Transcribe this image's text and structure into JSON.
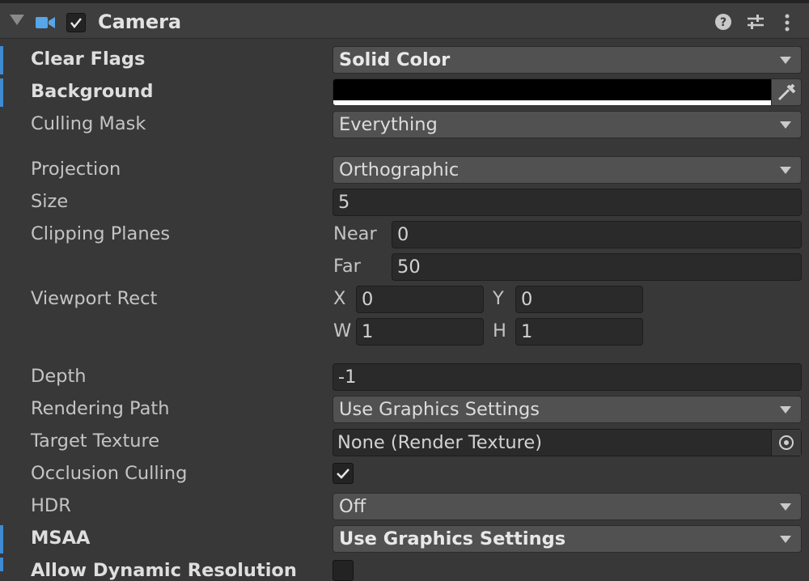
{
  "header": {
    "title": "Camera",
    "enabled": true,
    "icons": [
      "foldout-arrow-icon",
      "camera-icon",
      "help-icon",
      "presets-icon",
      "more-menu-icon"
    ]
  },
  "properties": {
    "clear_flags": {
      "label": "Clear Flags",
      "value": "Solid Color"
    },
    "background": {
      "label": "Background",
      "color": "#000000"
    },
    "culling_mask": {
      "label": "Culling Mask",
      "value": "Everything"
    },
    "projection": {
      "label": "Projection",
      "value": "Orthographic"
    },
    "size": {
      "label": "Size",
      "value": "5"
    },
    "clipping_planes": {
      "label": "Clipping Planes",
      "near_label": "Near",
      "near": "0",
      "far_label": "Far",
      "far": "50"
    },
    "viewport_rect": {
      "label": "Viewport Rect",
      "x_label": "X",
      "x": "0",
      "y_label": "Y",
      "y": "0",
      "w_label": "W",
      "w": "1",
      "h_label": "H",
      "h": "1"
    },
    "depth": {
      "label": "Depth",
      "value": "-1"
    },
    "rendering_path": {
      "label": "Rendering Path",
      "value": "Use Graphics Settings"
    },
    "target_texture": {
      "label": "Target Texture",
      "value": "None (Render Texture)"
    },
    "occlusion_culling": {
      "label": "Occlusion Culling",
      "checked": true
    },
    "hdr": {
      "label": "HDR",
      "value": "Off"
    },
    "msaa": {
      "label": "MSAA",
      "value": "Use Graphics Settings"
    },
    "allow_dynamic_resolution": {
      "label": "Allow Dynamic Resolution",
      "checked": false
    }
  },
  "colors": {
    "panel_bg": "#383838",
    "field_bg": "#2a2a2a",
    "dropdown_bg": "#515151",
    "modified_indicator": "#3f8ad1"
  }
}
